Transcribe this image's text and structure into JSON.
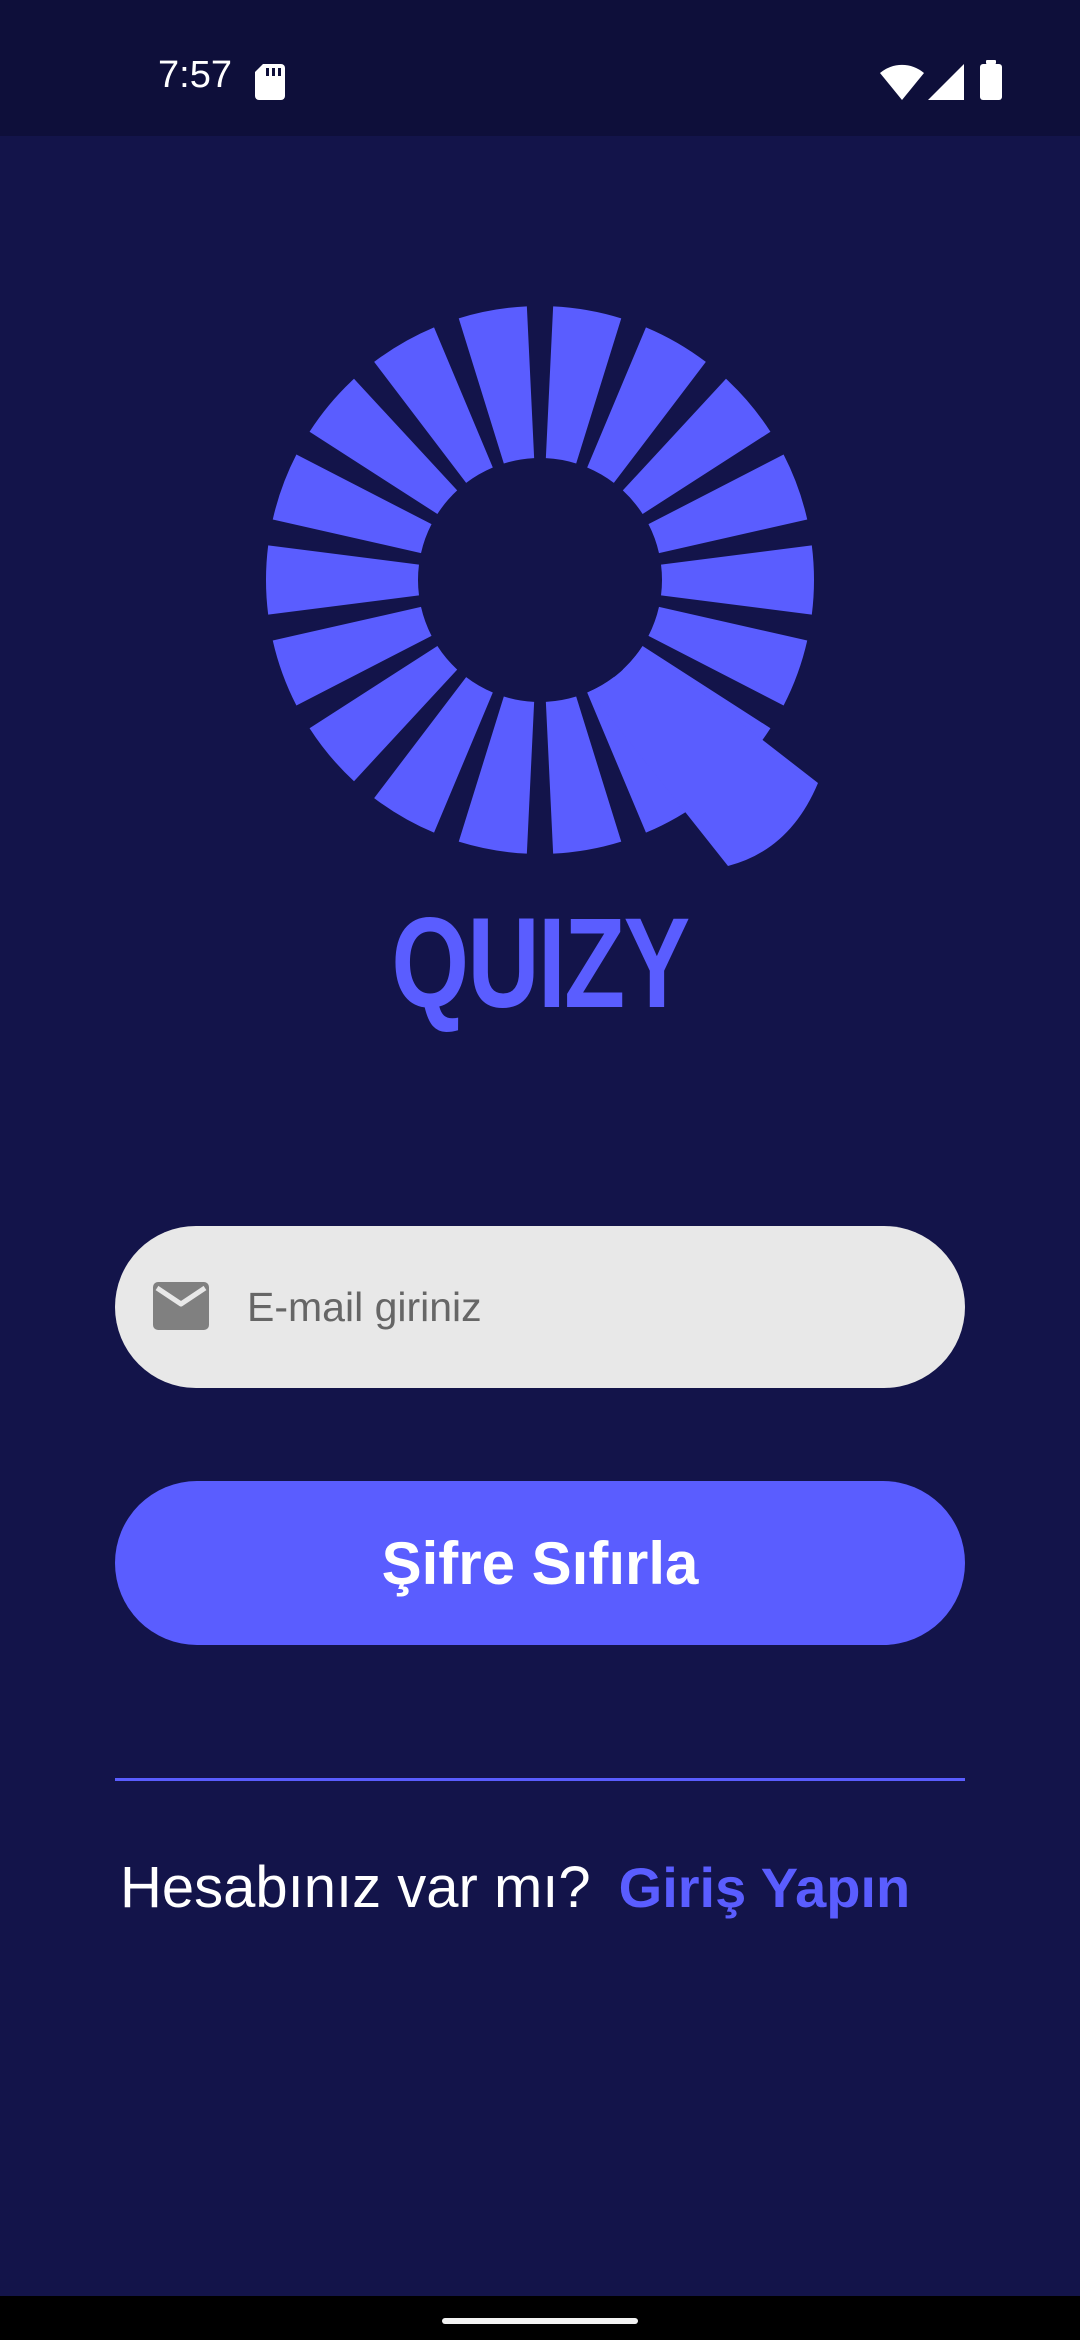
{
  "status_bar": {
    "time": "7:57",
    "icons": [
      "sd-card-icon",
      "wifi-icon",
      "cell-signal-icon",
      "battery-icon"
    ]
  },
  "app": {
    "name": "QUIZY",
    "brand_color": "#5a5dff",
    "background_color": "#13144a"
  },
  "form": {
    "email_placeholder": "E-mail giriniz",
    "email_value": "",
    "email_icon": "mail-icon",
    "reset_button_label": "Şifre Sıfırla"
  },
  "footer": {
    "question": "Hesabınız var mı?",
    "login_link": "Giriş Yapın"
  }
}
